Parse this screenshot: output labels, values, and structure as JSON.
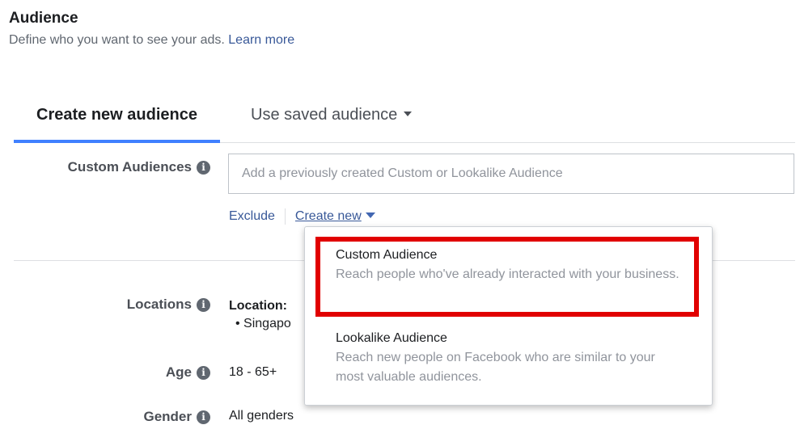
{
  "header": {
    "title": "Audience",
    "description": "Define who you want to see your ads.",
    "learn_more": "Learn more"
  },
  "tabs": {
    "create_new": "Create new audience",
    "use_saved": "Use saved audience"
  },
  "custom_audiences": {
    "label": "Custom Audiences",
    "placeholder": "Add a previously created Custom or Lookalike Audience",
    "exclude": "Exclude",
    "create_new": "Create new"
  },
  "locations": {
    "label": "Locations",
    "value_title": "Location:",
    "value_item": "Singapo"
  },
  "age": {
    "label": "Age",
    "value": "18 - 65+"
  },
  "gender": {
    "label": "Gender",
    "value": "All genders"
  },
  "dropdown": {
    "items": [
      {
        "title": "Custom Audience",
        "description": "Reach people who've already interacted with your business."
      },
      {
        "title": "Lookalike Audience",
        "description": "Reach new people on Facebook who are similar to your most valuable audiences."
      }
    ]
  },
  "icons": {
    "info": "info-icon",
    "caret": "caret-down-icon"
  },
  "colors": {
    "link": "#385898",
    "tab_accent": "#4080ff",
    "highlight": "#e10000"
  }
}
